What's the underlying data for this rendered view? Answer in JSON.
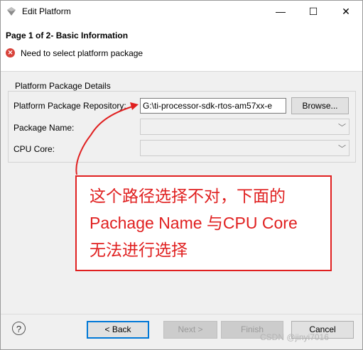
{
  "window": {
    "title": "Edit Platform",
    "minimize_glyph": "—",
    "maximize_glyph": "☐",
    "close_glyph": "✕"
  },
  "header": {
    "page_title": "Page 1 of 2- Basic Information",
    "error_message": "Need to select platform package",
    "error_icon": "error-icon"
  },
  "group": {
    "legend": "Platform Package Details",
    "repository_label": "Platform Package Repository:",
    "repository_value": "G:\\ti-processor-sdk-rtos-am57xx-e",
    "browse_label": "Browse...",
    "package_name_label": "Package Name:",
    "package_name_value": "",
    "cpu_core_label": "CPU Core:",
    "cpu_core_value": ""
  },
  "annotation": {
    "line1": "这个路径选择不对，下面的",
    "line2": "Pachage Name 与CPU Core",
    "line3": "无法进行选择",
    "color": "#e02020"
  },
  "footer": {
    "help_glyph": "?",
    "back_label": "< Back",
    "next_label": "Next >",
    "finish_label": "Finish",
    "cancel_label": "Cancel",
    "watermark": "CSDN @jinyi7016"
  }
}
